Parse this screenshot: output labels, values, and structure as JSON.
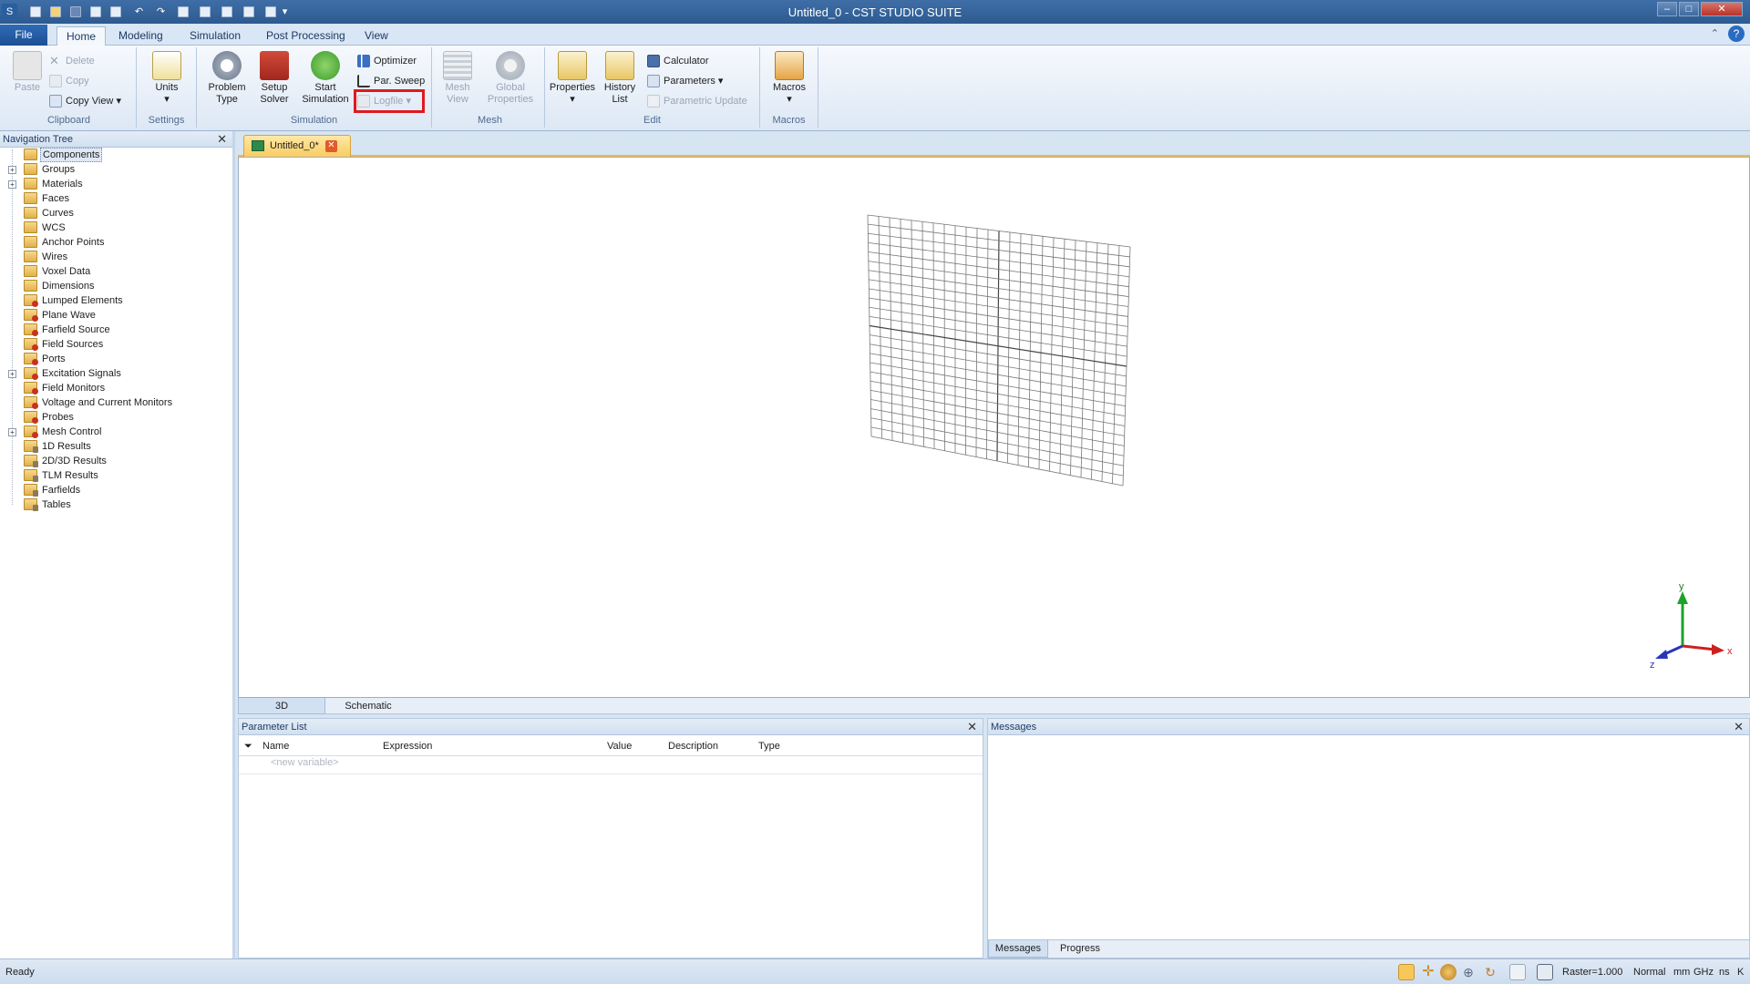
{
  "window": {
    "title": "Untitled_0 - CST STUDIO SUITE",
    "controls": [
      "minimize",
      "maximize",
      "close"
    ]
  },
  "ribbon_tabs": [
    "File",
    "Home",
    "Modeling",
    "Simulation",
    "Post Processing",
    "View"
  ],
  "active_tab": "Home",
  "ribbon": {
    "clipboard": {
      "label": "Clipboard",
      "paste": "Paste",
      "delete": "Delete",
      "copy": "Copy",
      "copy_view": "Copy View"
    },
    "settings": {
      "label": "Settings",
      "units": "Units"
    },
    "simulation": {
      "label": "Simulation",
      "problem_type": "Problem Type",
      "setup_solver": "Setup Solver",
      "start_simulation": "Start Simulation",
      "optimizer": "Optimizer",
      "par_sweep": "Par. Sweep",
      "logfile": "Logfile"
    },
    "mesh": {
      "label": "Mesh",
      "mesh_view": "Mesh View",
      "global_properties": "Global Properties"
    },
    "edit": {
      "label": "Edit",
      "properties": "Properties",
      "history_list": "History List",
      "calculator": "Calculator",
      "parameters": "Parameters",
      "parametric_update": "Parametric Update"
    },
    "macros": {
      "label": "Macros",
      "macros": "Macros"
    }
  },
  "navigation_tree": {
    "title": "Navigation Tree",
    "items": [
      {
        "label": "Components",
        "expandable": false,
        "icon": "folder",
        "selected": true
      },
      {
        "label": "Groups",
        "expandable": true,
        "icon": "folder"
      },
      {
        "label": "Materials",
        "expandable": true,
        "icon": "folder"
      },
      {
        "label": "Faces",
        "expandable": false,
        "icon": "folder"
      },
      {
        "label": "Curves",
        "expandable": false,
        "icon": "folder"
      },
      {
        "label": "WCS",
        "expandable": false,
        "icon": "folder"
      },
      {
        "label": "Anchor Points",
        "expandable": false,
        "icon": "folder"
      },
      {
        "label": "Wires",
        "expandable": false,
        "icon": "folder"
      },
      {
        "label": "Voxel Data",
        "expandable": false,
        "icon": "folder"
      },
      {
        "label": "Dimensions",
        "expandable": false,
        "icon": "folder"
      },
      {
        "label": "Lumped Elements",
        "expandable": false,
        "icon": "folder-red"
      },
      {
        "label": "Plane Wave",
        "expandable": false,
        "icon": "folder-red"
      },
      {
        "label": "Farfield Source",
        "expandable": false,
        "icon": "folder-red"
      },
      {
        "label": "Field Sources",
        "expandable": false,
        "icon": "folder-red"
      },
      {
        "label": "Ports",
        "expandable": false,
        "icon": "folder-red"
      },
      {
        "label": "Excitation Signals",
        "expandable": true,
        "icon": "folder-red"
      },
      {
        "label": "Field Monitors",
        "expandable": false,
        "icon": "folder-red"
      },
      {
        "label": "Voltage and Current Monitors",
        "expandable": false,
        "icon": "folder-red"
      },
      {
        "label": "Probes",
        "expandable": false,
        "icon": "folder-red"
      },
      {
        "label": "Mesh Control",
        "expandable": true,
        "icon": "folder-red"
      },
      {
        "label": "1D Results",
        "expandable": false,
        "icon": "folder-lock"
      },
      {
        "label": "2D/3D Results",
        "expandable": false,
        "icon": "folder-lock"
      },
      {
        "label": "TLM Results",
        "expandable": false,
        "icon": "folder-lock"
      },
      {
        "label": "Farfields",
        "expandable": false,
        "icon": "folder-lock"
      },
      {
        "label": "Tables",
        "expandable": false,
        "icon": "folder-lock"
      }
    ]
  },
  "document_tab": "Untitled_0*",
  "view_tabs": [
    "3D",
    "Schematic"
  ],
  "axes": {
    "x": "x",
    "y": "y",
    "z": "z"
  },
  "parameter_list": {
    "title": "Parameter List",
    "columns": [
      "Name",
      "Expression",
      "Value",
      "Description",
      "Type"
    ],
    "placeholder_row": "<new variable>"
  },
  "messages": {
    "title": "Messages",
    "tabs": [
      "Messages",
      "Progress"
    ]
  },
  "status_bar": {
    "status": "Ready",
    "raster": "Raster=1.000",
    "mode": "Normal",
    "units": [
      "mm",
      "GHz",
      "ns",
      "K"
    ]
  },
  "colors": {
    "accent": "#2d5a90",
    "highlight": "#e0181e",
    "doc_tab": "#f9cc62"
  }
}
